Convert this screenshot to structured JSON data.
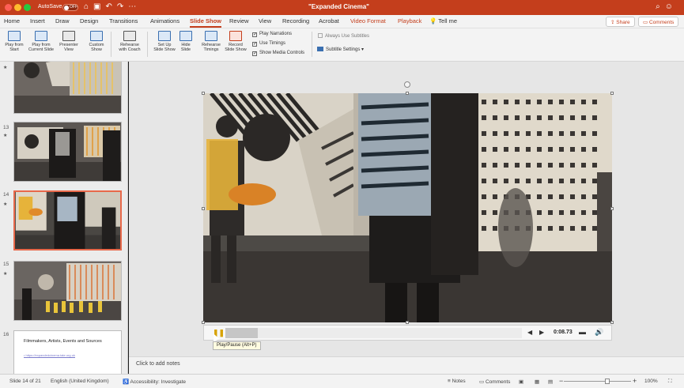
{
  "titlebar": {
    "autosave_label": "AutoSave",
    "autosave_state": "OFF",
    "document_title": "\"Expanded Cinema\"",
    "icons": [
      "home-icon",
      "save-icon",
      "undo-icon",
      "redo-icon",
      "more-icon"
    ]
  },
  "ribbon_tabs": [
    {
      "label": "Home"
    },
    {
      "label": "Insert"
    },
    {
      "label": "Draw"
    },
    {
      "label": "Design"
    },
    {
      "label": "Transitions"
    },
    {
      "label": "Animations"
    },
    {
      "label": "Slide Show"
    },
    {
      "label": "Review"
    },
    {
      "label": "View"
    },
    {
      "label": "Recording"
    },
    {
      "label": "Acrobat"
    },
    {
      "label": "Video Format"
    },
    {
      "label": "Playback"
    },
    {
      "label": "Tell me"
    }
  ],
  "active_tab": "Slide Show",
  "share": {
    "share_label": "Share",
    "comments_label": "Comments"
  },
  "ribbon_commands": [
    {
      "line1": "Play from",
      "line2": "Start"
    },
    {
      "line1": "Play from",
      "line2": "Current Slide"
    },
    {
      "line1": "Presenter",
      "line2": "View"
    },
    {
      "line1": "Custom",
      "line2": "Show"
    },
    {
      "line1": "Rehearse",
      "line2": "with Coach"
    },
    {
      "line1": "Set Up",
      "line2": "Slide Show"
    },
    {
      "line1": "Hide",
      "line2": "Slide"
    },
    {
      "line1": "Rehearse",
      "line2": "Timings"
    },
    {
      "line1": "Record",
      "line2": "Slide Show"
    }
  ],
  "checkboxes": [
    {
      "label": "Play Narrations",
      "checked": "✓"
    },
    {
      "label": "Use Timings",
      "checked": "✓"
    },
    {
      "label": "Show Media Controls",
      "checked": "✓"
    }
  ],
  "subtitles": {
    "always_use_label": "Always Use Subtitles",
    "settings_label": "Subtitle Settings"
  },
  "thumbnails": [
    {
      "number": "",
      "star": "★"
    },
    {
      "number": "13",
      "star": "★"
    },
    {
      "number": "14",
      "star": "★"
    },
    {
      "number": "15",
      "star": "★"
    },
    {
      "number": "16",
      "star": ""
    }
  ],
  "slide16": {
    "title": "Filmmakers, Artists, Events and Sources",
    "link": "• https://expandedcinema.tate.org.uk"
  },
  "media_controls": {
    "progress_fraction": 0.11,
    "time": "0:08.73",
    "tooltip": "Play/Pause (Alt+P)"
  },
  "notes_placeholder": "Click to add notes",
  "statusbar": {
    "slide_info": "Slide 14 of 21",
    "language": "English (United Kingdom)",
    "accessibility": "Accessibility: Investigate",
    "notes_label": "Notes",
    "comments_label": "Comments",
    "zoom": "100%"
  },
  "colors": {
    "accent": "#c43e1c",
    "selected_thumb_border": "#e8684a"
  }
}
